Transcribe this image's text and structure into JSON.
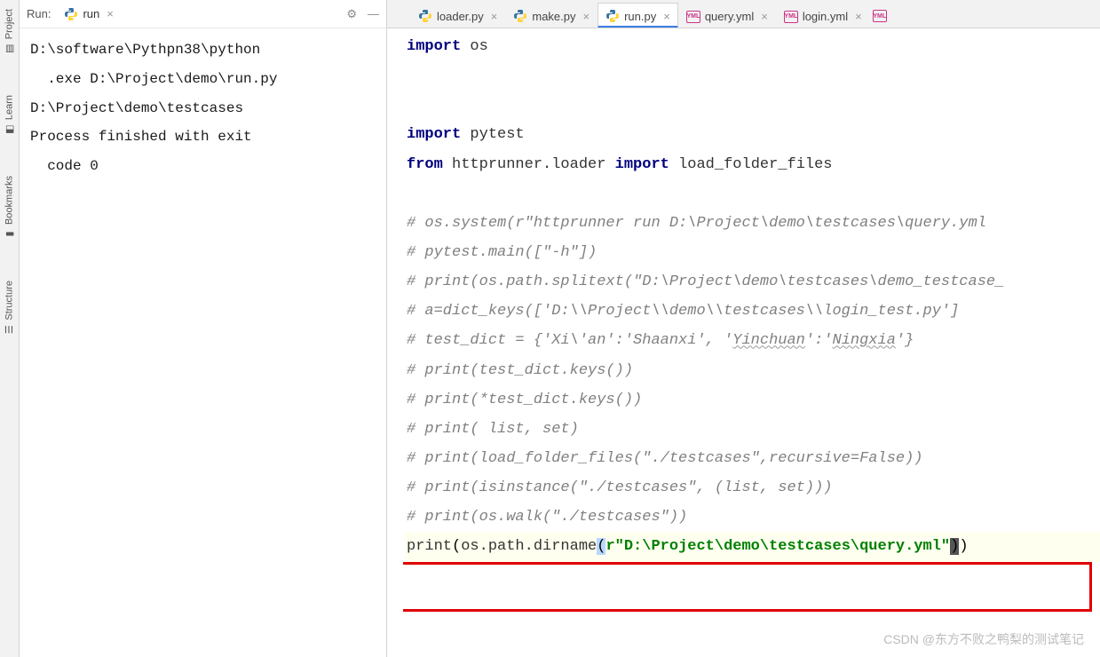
{
  "sidebar": {
    "tabs": [
      "Project",
      "Learn",
      "Bookmarks",
      "Structure"
    ]
  },
  "runPanel": {
    "label": "Run:",
    "tab": {
      "name": "run",
      "close": "×"
    },
    "icons": {
      "gear": "⚙",
      "min": "—"
    },
    "console": [
      "D:\\software\\Pythpn38\\python",
      "  .exe D:\\Project\\demo\\run.py",
      "D:\\Project\\demo\\testcases",
      "",
      "Process finished with exit ",
      "  code 0"
    ]
  },
  "editor": {
    "tabs": [
      {
        "name": "loader.py",
        "type": "py",
        "active": false,
        "close": "×"
      },
      {
        "name": "make.py",
        "type": "py",
        "active": false,
        "close": "×"
      },
      {
        "name": "run.py",
        "type": "py",
        "active": true,
        "close": "×"
      },
      {
        "name": "query.yml",
        "type": "yml",
        "active": false,
        "close": "×"
      },
      {
        "name": "login.yml",
        "type": "yml",
        "active": false,
        "close": "×"
      }
    ],
    "code": {
      "l1": {
        "kw": "import",
        "m": " os"
      },
      "l4": {
        "kw": "import",
        "m": " pytest"
      },
      "l5": {
        "kw1": "from",
        "m1": " httprunner.loader ",
        "kw2": "import",
        "m2": " load_folder_files"
      },
      "c1": "# os.system(r\"httprunner run D:\\Project\\demo\\testcases\\query.yml ",
      "c2": "# pytest.main([\"-h\"])",
      "c3": "# print(os.path.splitext(\"D:\\Project\\demo\\testcases\\demo_testcase_",
      "c4": "# a=dict_keys(['D:\\\\Project\\\\demo\\\\testcases\\\\login_test.py']",
      "c5_a": "# test_dict = {'Xi\\'an':'Shaanxi', '",
      "c5_wav1": "Yinchuan",
      "c5_b": "':'",
      "c5_wav2": "Ningxia",
      "c5_c": "'}",
      "c6": "# print(test_dict.keys())",
      "c7": "# print(*test_dict.keys())",
      "c8": "# print( list, set)",
      "c9": "# print(load_folder_files(\"./testcases\",recursive=False))",
      "c10": "# print(isinstance(\"./testcases\", (list, set)))",
      "c11": "# print(os.walk(\"./testcases\"))",
      "pl": {
        "fn": "print",
        "p1": "(",
        "id": "os.path.dirname",
        "p2": "(",
        "s": "r\"D:\\Project\\demo\\testcases\\query.yml\"",
        "p3": ")",
        ")": ")"
      }
    }
  },
  "watermark": "CSDN @东方不败之鸭梨的测试笔记"
}
